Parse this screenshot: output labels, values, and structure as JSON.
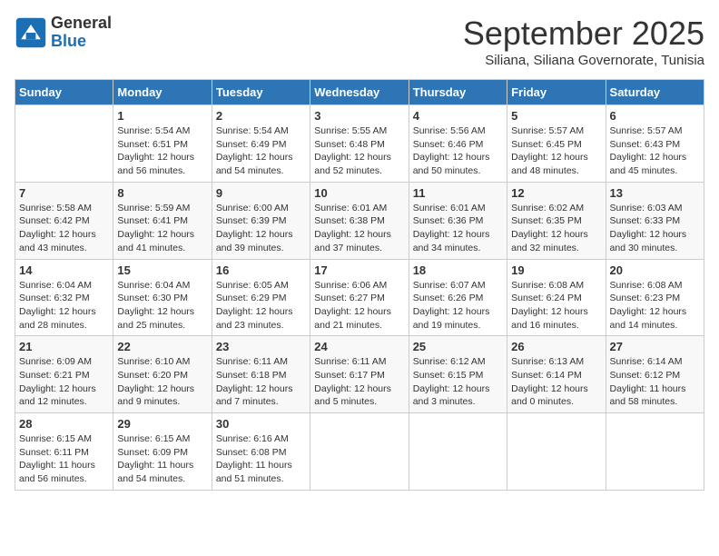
{
  "header": {
    "logo_line1": "General",
    "logo_line2": "Blue",
    "month_title": "September 2025",
    "subtitle": "Siliana, Siliana Governorate, Tunisia"
  },
  "calendar": {
    "days_of_week": [
      "Sunday",
      "Monday",
      "Tuesday",
      "Wednesday",
      "Thursday",
      "Friday",
      "Saturday"
    ],
    "weeks": [
      [
        {
          "day": "",
          "info": ""
        },
        {
          "day": "1",
          "info": "Sunrise: 5:54 AM\nSunset: 6:51 PM\nDaylight: 12 hours\nand 56 minutes."
        },
        {
          "day": "2",
          "info": "Sunrise: 5:54 AM\nSunset: 6:49 PM\nDaylight: 12 hours\nand 54 minutes."
        },
        {
          "day": "3",
          "info": "Sunrise: 5:55 AM\nSunset: 6:48 PM\nDaylight: 12 hours\nand 52 minutes."
        },
        {
          "day": "4",
          "info": "Sunrise: 5:56 AM\nSunset: 6:46 PM\nDaylight: 12 hours\nand 50 minutes."
        },
        {
          "day": "5",
          "info": "Sunrise: 5:57 AM\nSunset: 6:45 PM\nDaylight: 12 hours\nand 48 minutes."
        },
        {
          "day": "6",
          "info": "Sunrise: 5:57 AM\nSunset: 6:43 PM\nDaylight: 12 hours\nand 45 minutes."
        }
      ],
      [
        {
          "day": "7",
          "info": "Sunrise: 5:58 AM\nSunset: 6:42 PM\nDaylight: 12 hours\nand 43 minutes."
        },
        {
          "day": "8",
          "info": "Sunrise: 5:59 AM\nSunset: 6:41 PM\nDaylight: 12 hours\nand 41 minutes."
        },
        {
          "day": "9",
          "info": "Sunrise: 6:00 AM\nSunset: 6:39 PM\nDaylight: 12 hours\nand 39 minutes."
        },
        {
          "day": "10",
          "info": "Sunrise: 6:01 AM\nSunset: 6:38 PM\nDaylight: 12 hours\nand 37 minutes."
        },
        {
          "day": "11",
          "info": "Sunrise: 6:01 AM\nSunset: 6:36 PM\nDaylight: 12 hours\nand 34 minutes."
        },
        {
          "day": "12",
          "info": "Sunrise: 6:02 AM\nSunset: 6:35 PM\nDaylight: 12 hours\nand 32 minutes."
        },
        {
          "day": "13",
          "info": "Sunrise: 6:03 AM\nSunset: 6:33 PM\nDaylight: 12 hours\nand 30 minutes."
        }
      ],
      [
        {
          "day": "14",
          "info": "Sunrise: 6:04 AM\nSunset: 6:32 PM\nDaylight: 12 hours\nand 28 minutes."
        },
        {
          "day": "15",
          "info": "Sunrise: 6:04 AM\nSunset: 6:30 PM\nDaylight: 12 hours\nand 25 minutes."
        },
        {
          "day": "16",
          "info": "Sunrise: 6:05 AM\nSunset: 6:29 PM\nDaylight: 12 hours\nand 23 minutes."
        },
        {
          "day": "17",
          "info": "Sunrise: 6:06 AM\nSunset: 6:27 PM\nDaylight: 12 hours\nand 21 minutes."
        },
        {
          "day": "18",
          "info": "Sunrise: 6:07 AM\nSunset: 6:26 PM\nDaylight: 12 hours\nand 19 minutes."
        },
        {
          "day": "19",
          "info": "Sunrise: 6:08 AM\nSunset: 6:24 PM\nDaylight: 12 hours\nand 16 minutes."
        },
        {
          "day": "20",
          "info": "Sunrise: 6:08 AM\nSunset: 6:23 PM\nDaylight: 12 hours\nand 14 minutes."
        }
      ],
      [
        {
          "day": "21",
          "info": "Sunrise: 6:09 AM\nSunset: 6:21 PM\nDaylight: 12 hours\nand 12 minutes."
        },
        {
          "day": "22",
          "info": "Sunrise: 6:10 AM\nSunset: 6:20 PM\nDaylight: 12 hours\nand 9 minutes."
        },
        {
          "day": "23",
          "info": "Sunrise: 6:11 AM\nSunset: 6:18 PM\nDaylight: 12 hours\nand 7 minutes."
        },
        {
          "day": "24",
          "info": "Sunrise: 6:11 AM\nSunset: 6:17 PM\nDaylight: 12 hours\nand 5 minutes."
        },
        {
          "day": "25",
          "info": "Sunrise: 6:12 AM\nSunset: 6:15 PM\nDaylight: 12 hours\nand 3 minutes."
        },
        {
          "day": "26",
          "info": "Sunrise: 6:13 AM\nSunset: 6:14 PM\nDaylight: 12 hours\nand 0 minutes."
        },
        {
          "day": "27",
          "info": "Sunrise: 6:14 AM\nSunset: 6:12 PM\nDaylight: 11 hours\nand 58 minutes."
        }
      ],
      [
        {
          "day": "28",
          "info": "Sunrise: 6:15 AM\nSunset: 6:11 PM\nDaylight: 11 hours\nand 56 minutes."
        },
        {
          "day": "29",
          "info": "Sunrise: 6:15 AM\nSunset: 6:09 PM\nDaylight: 11 hours\nand 54 minutes."
        },
        {
          "day": "30",
          "info": "Sunrise: 6:16 AM\nSunset: 6:08 PM\nDaylight: 11 hours\nand 51 minutes."
        },
        {
          "day": "",
          "info": ""
        },
        {
          "day": "",
          "info": ""
        },
        {
          "day": "",
          "info": ""
        },
        {
          "day": "",
          "info": ""
        }
      ]
    ]
  }
}
